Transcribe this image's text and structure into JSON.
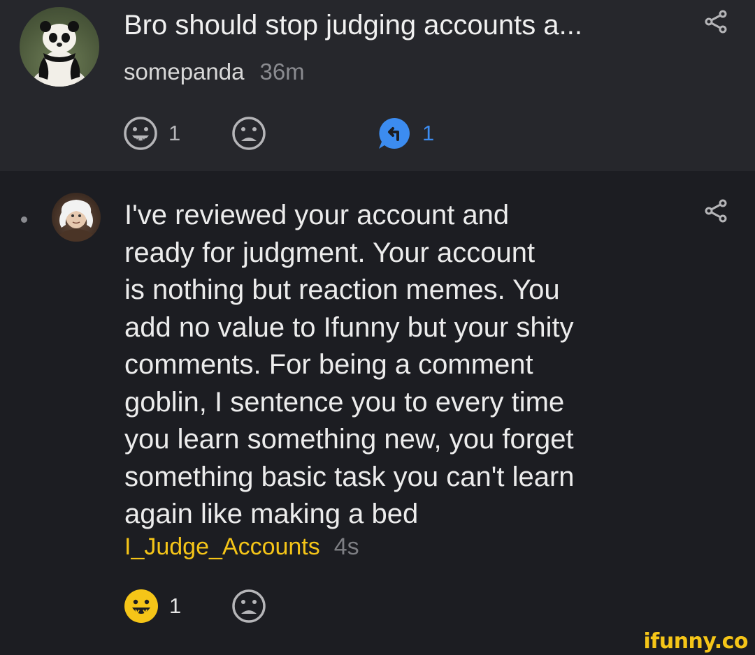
{
  "parent_post": {
    "title": "Bro should stop judging accounts a...",
    "username": "somepanda",
    "time": "36m",
    "upvotes": "1",
    "replies": "1"
  },
  "reply_comment": {
    "text": "I've reviewed your account and\nready for judgment. Your account\nis nothing but reaction memes. You\nadd no value to Ifunny but your shity\ncomments. For being a comment\ngoblin, I sentence you to every time\nyou learn something new, you forget\nsomething basic task you can't learn\nagain like making a bed",
    "username": "I_Judge_Accounts",
    "time": "4s",
    "upvotes": "1"
  },
  "watermark": "ifunny.co",
  "colors": {
    "accent_yellow": "#f5c518",
    "reply_blue": "#3c8cf0",
    "icon_gray": "#b5b5b8",
    "background": "#1c1d22",
    "parent_background": "#26272c"
  },
  "icons": [
    "share-icon",
    "smile-icon",
    "frown-icon",
    "reply-bubble-icon"
  ]
}
